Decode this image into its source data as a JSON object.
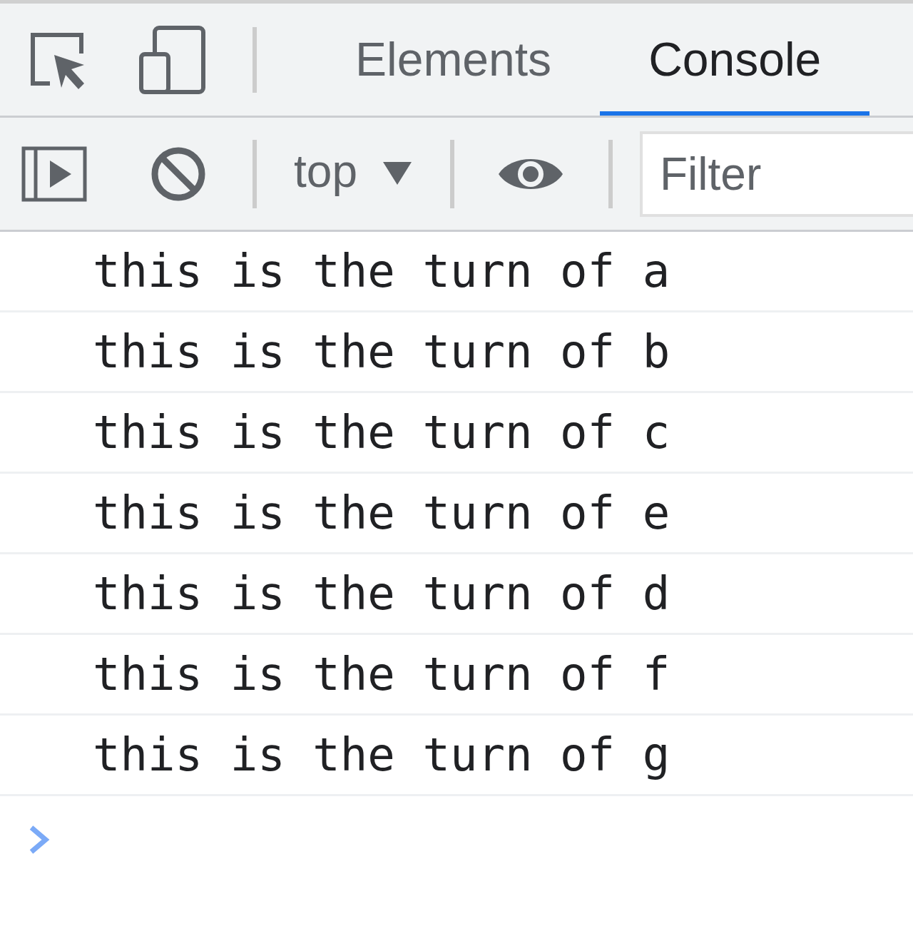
{
  "tabs": [
    {
      "label": "Elements",
      "selected": false
    },
    {
      "label": "Console",
      "selected": true
    }
  ],
  "toolbar": {
    "context": "top",
    "filter": {
      "placeholder": "Filter"
    }
  },
  "messages": [
    "this is the turn of a",
    "this is the turn of b",
    "this is the turn of c",
    "this is the turn of e",
    "this is the turn of d",
    "this is the turn of f",
    "this is the turn of g"
  ]
}
